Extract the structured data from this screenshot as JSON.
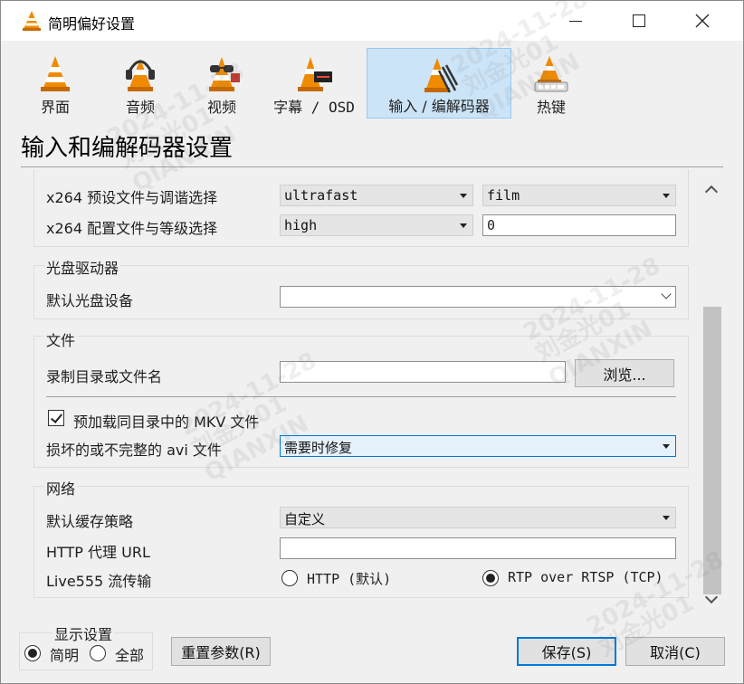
{
  "window": {
    "title": "简明偏好设置"
  },
  "toolbar": {
    "items": [
      {
        "label": "界面",
        "icon": "interface-cone-icon"
      },
      {
        "label": "音频",
        "icon": "audio-headphones-cone-icon"
      },
      {
        "label": "视频",
        "icon": "video-glasses-cone-icon"
      },
      {
        "label": "字幕 / OSD",
        "icon": "subtitles-cone-icon"
      },
      {
        "label": "输入 / 编解码器",
        "icon": "input-codecs-cone-icon"
      },
      {
        "label": "热键",
        "icon": "hotkeys-cone-icon"
      }
    ],
    "selected": "输入 / 编解码器"
  },
  "page": {
    "heading": "输入和编解码器设置"
  },
  "codecs": {
    "x264_preset_label": "x264 预设文件与调谐选择",
    "x264_preset_value": "ultrafast",
    "x264_tune_value": "film",
    "x264_profile_label": "x264 配置文件与等级选择",
    "x264_profile_value": "high",
    "x264_level_value": "0"
  },
  "optical": {
    "title": "光盘驱动器",
    "device_label": "默认光盘设备",
    "device_value": ""
  },
  "files": {
    "title": "文件",
    "record_label": "录制目录或文件名",
    "record_value": "",
    "browse_label": "浏览...",
    "preload_mkv_label": "预加载同目录中的 MKV 文件",
    "preload_mkv_checked": true,
    "avi_label": "损坏的或不完整的 avi 文件",
    "avi_value": "需要时修复"
  },
  "network": {
    "title": "网络",
    "cache_label": "默认缓存策略",
    "cache_value": "自定义",
    "proxy_label": "HTTP 代理 URL",
    "proxy_value": "",
    "live555_label": "Live555 流传输",
    "live555_http": "HTTP (默认)",
    "live555_rtsp": "RTP over RTSP (TCP)",
    "live555_selected": "RTP over RTSP (TCP)"
  },
  "footer": {
    "show_settings_title": "显示设置",
    "simple_label": "简明",
    "all_label": "全部",
    "show_selected": "简明",
    "reset_label": "重置参数(R)",
    "save_label": "保存(S)",
    "cancel_label": "取消(C)"
  },
  "watermark": {
    "lines": [
      "2024-11-28",
      "刘金光01",
      "QIANXIN"
    ]
  },
  "colors": {
    "selected_tab_bg": "#cce4f7",
    "selected_tab_border": "#99c9ef",
    "accent": "#0078d7",
    "cone_orange": "#f08a00"
  }
}
